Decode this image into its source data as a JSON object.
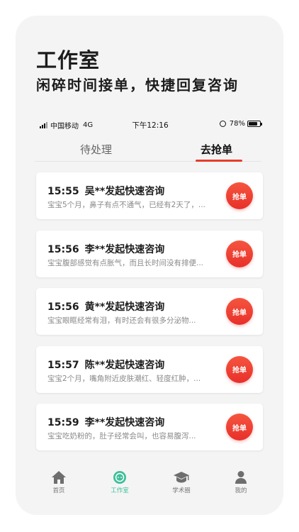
{
  "hero": {
    "title": "工作室",
    "subtitle": "闲碎时间接单，快捷回复咨询"
  },
  "status_bar": {
    "carrier": "中国移动",
    "network": "4G",
    "time": "下午12:16",
    "battery": "78%",
    "battery_level": 0.78
  },
  "tabs": [
    {
      "label": "待处理",
      "active": false
    },
    {
      "label": "去抢单",
      "active": true
    }
  ],
  "accent_color": "#e63c2a",
  "active_nav_color": "#3dbf9a",
  "cards": [
    {
      "time": "15:55",
      "title": "吴**发起快速咨询",
      "desc": "宝宝5个月，鼻子有点不通气，已经有2天了，...",
      "button": "抢单"
    },
    {
      "time": "15:56",
      "title": "李**发起快速咨询",
      "desc": "宝宝腹部感觉有点胀气，而且长时间没有排便...",
      "button": "抢单"
    },
    {
      "time": "15:56",
      "title": "黄**发起快速咨询",
      "desc": "宝宝眼眶经常有泪，有时还会有很多分泌物...",
      "button": "抢单"
    },
    {
      "time": "15:57",
      "title": "陈**发起快速咨询",
      "desc": "宝宝2个月，嘴角附近皮肤潮红、轻度红肿，...",
      "button": "抢单"
    },
    {
      "time": "15:59",
      "title": "李**发起快速咨询",
      "desc": "宝宝吃奶粉的，肚子经常会叫，也容易腹泻...",
      "button": "抢单"
    }
  ],
  "nav": [
    {
      "label": "首页",
      "icon": "home-icon",
      "active": false
    },
    {
      "label": "工作室",
      "icon": "chat-bubble-icon",
      "active": true
    },
    {
      "label": "学术圈",
      "icon": "graduation-cap-icon",
      "active": false
    },
    {
      "label": "我的",
      "icon": "person-icon",
      "active": false
    }
  ]
}
